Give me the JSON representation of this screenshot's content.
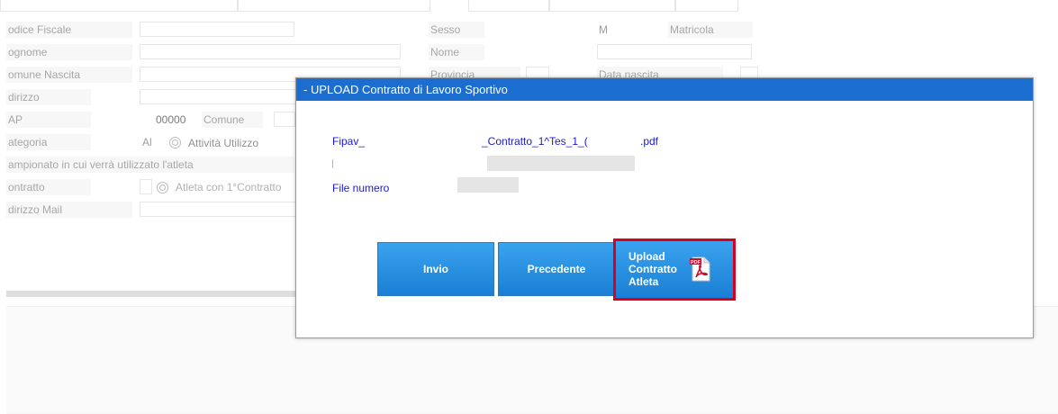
{
  "form": {
    "codice_fiscale": "odice Fiscale",
    "cognome": "ognome",
    "comune_nascita": "omune Nascita",
    "indirizzo": "dirizzo",
    "cap": "AP",
    "categoria": "ategoria",
    "campionato": "ampionato in cui verrà utilizzato l'atleta",
    "contratto": "ontratto",
    "indirizzo_mail": "dirizzo Mail",
    "cap_value": "00000",
    "comune": "Comune",
    "categoria_value": "Al",
    "attivita_utilizzo": "Attività Utilizzo",
    "atleta_1_contratto": "Atleta con 1°Contratto",
    "sesso": "Sesso",
    "sesso_value": "M",
    "matricola": "Matricola",
    "nome": "Nome",
    "provincia": "Provincia",
    "data_nascita": "Data nascita"
  },
  "dialog": {
    "title": "- UPLOAD Contratto di Lavoro Sportivo",
    "file_prefix": "Fipav_",
    "file_middle": "_Contratto_1^Tes_1_(",
    "file_ext": ".pdf",
    "file_numero_label": "File numero",
    "buttons": {
      "invio": "Invio",
      "precedente": "Precedente",
      "upload_line1": "Upload",
      "upload_line2": "Contratto",
      "upload_line3": "Atleta"
    },
    "pdf_badge": "PDF",
    "colors": {
      "title_bar": "#1c6dd0",
      "button": "#2a90e0",
      "highlight": "#d7001d",
      "link_text": "#1a1ad6"
    }
  }
}
